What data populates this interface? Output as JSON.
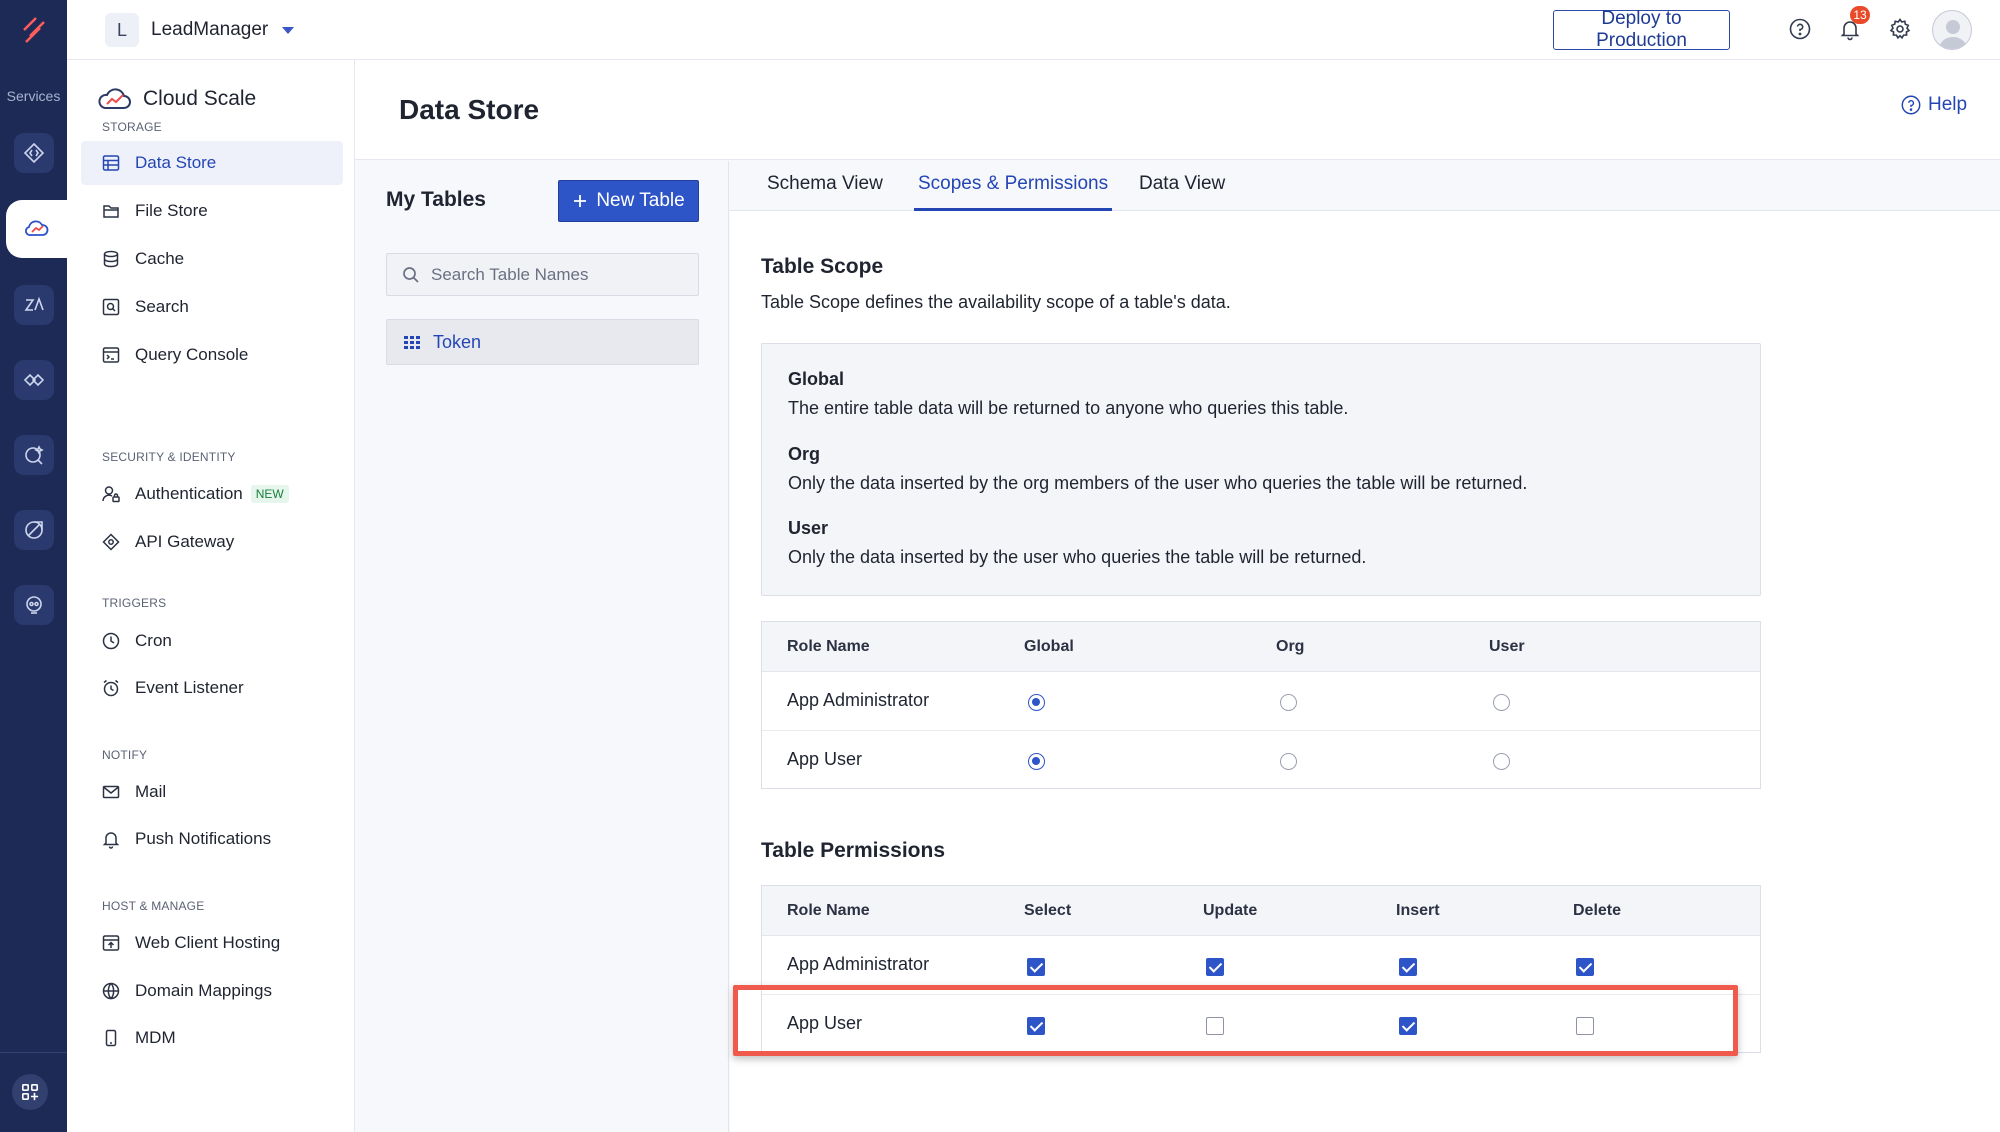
{
  "rail": {
    "services_label": "Services",
    "icons": [
      "catalyst-logo-icon",
      "serverless-icon",
      "cloud-scale-icon",
      "zia-icon",
      "devops-icon",
      "quickml-icon",
      "smart-browz-icon",
      "signals-icon",
      "apps-grid-icon"
    ]
  },
  "topbar": {
    "project_initial": "L",
    "project_name": "LeadManager",
    "deploy_label": "Deploy to Production",
    "notification_count": "13"
  },
  "sidebar": {
    "service_title": "Cloud Scale",
    "sections": {
      "storage": "STORAGE",
      "security": "SECURITY & IDENTITY",
      "triggers": "TRIGGERS",
      "notify": "NOTIFY",
      "host": "HOST & MANAGE"
    },
    "items": {
      "data_store": "Data Store",
      "file_store": "File Store",
      "cache": "Cache",
      "search": "Search",
      "query_console": "Query Console",
      "authentication": "Authentication",
      "new_tag": "NEW",
      "api_gateway": "API Gateway",
      "cron": "Cron",
      "event_listener": "Event Listener",
      "mail": "Mail",
      "push_notifications": "Push Notifications",
      "web_client_hosting": "Web Client Hosting",
      "domain_mappings": "Domain Mappings",
      "mdm": "MDM"
    }
  },
  "page": {
    "title": "Data Store",
    "help_label": "Help"
  },
  "tables_panel": {
    "title": "My Tables",
    "new_table_label": "New Table",
    "search_placeholder": "Search Table Names",
    "tables": [
      "Token"
    ]
  },
  "tabs": [
    "Schema View",
    "Scopes & Permissions",
    "Data View"
  ],
  "active_tab": "Scopes & Permissions",
  "scope": {
    "title": "Table Scope",
    "description": "Table Scope defines the availability scope of a table's data.",
    "options": [
      {
        "name": "Global",
        "text": "The entire table data will be returned to anyone who queries this table."
      },
      {
        "name": "Org",
        "text": "Only the data inserted by the org members of the user who queries the table will be returned."
      },
      {
        "name": "User",
        "text": "Only the data inserted by the user who queries the table will be returned."
      }
    ],
    "columns": [
      "Role Name",
      "Global",
      "Org",
      "User"
    ],
    "rows": [
      {
        "role": "App Administrator",
        "selected": "Global"
      },
      {
        "role": "App User",
        "selected": "Global"
      }
    ]
  },
  "permissions": {
    "title": "Table Permissions",
    "columns": [
      "Role Name",
      "Select",
      "Update",
      "Insert",
      "Delete"
    ],
    "rows": [
      {
        "role": "App Administrator",
        "select": true,
        "update": true,
        "insert": true,
        "delete": true
      },
      {
        "role": "App User",
        "select": true,
        "update": false,
        "insert": true,
        "delete": false
      }
    ]
  },
  "colors": {
    "rail_bg": "#1d2a55",
    "accent": "#2d55c7",
    "highlight": "#ef5a4c"
  }
}
